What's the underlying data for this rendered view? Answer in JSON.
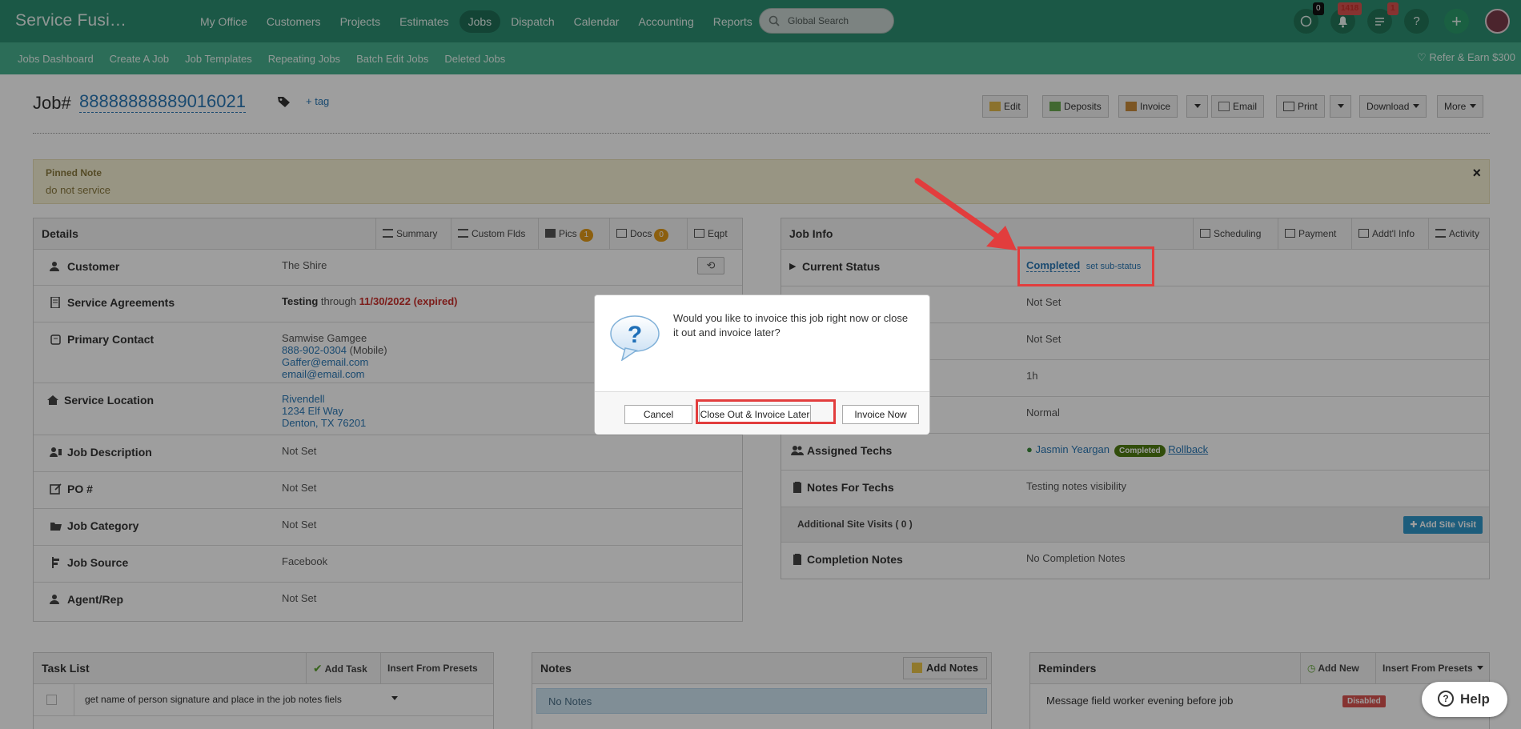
{
  "app": {
    "brand": "Service Fusi…"
  },
  "mainnav": [
    "My Office",
    "Customers",
    "Projects",
    "Estimates",
    "Jobs",
    "Dispatch",
    "Calendar",
    "Accounting",
    "Reports"
  ],
  "search": {
    "placeholder": "Global Search"
  },
  "top_icons": {
    "chat_badge": "0",
    "bell_badge": "1418",
    "list_badge": "1",
    "help_symbol": "?",
    "add_symbol": "+"
  },
  "subnav": [
    "Jobs Dashboard",
    "Create A Job",
    "Job Templates",
    "Repeating Jobs",
    "Batch Edit Jobs",
    "Deleted Jobs"
  ],
  "refer": "Refer & Earn $300",
  "job": {
    "label": "Job#",
    "number": "88888888889016021",
    "add_tag": "+ tag"
  },
  "actions": {
    "edit": "Edit",
    "deposits": "Deposits",
    "invoice": "Invoice",
    "email": "Email",
    "print": "Print",
    "download": "Download",
    "more": "More"
  },
  "pinned": {
    "title": "Pinned Note",
    "body": "do not service",
    "close": "×"
  },
  "details": {
    "title": "Details",
    "tabs": {
      "summary": "Summary",
      "custom": "Custom Flds",
      "pics": "Pics",
      "pics_count": "1",
      "docs": "Docs",
      "docs_count": "0",
      "eqpt": "Eqpt"
    },
    "customer_label": "Customer",
    "customer_value": "The Shire",
    "agreements_label": "Service Agreements",
    "agreements_name": "Testing",
    "agreements_through": "through",
    "agreements_date": "11/30/2022 (expired)",
    "contact_label": "Primary Contact",
    "contact_name": "Samwise Gamgee",
    "contact_phone": "888-902-0304",
    "contact_phone_type": "(Mobile)",
    "contact_email1": "Gaffer@email.com",
    "contact_email2": "email@email.com",
    "location_label": "Service Location",
    "location_name": "Rivendell",
    "location_street": "1234 Elf Way",
    "location_city": "Denton, TX 76201",
    "description_label": "Job Description",
    "description_value": "Not Set",
    "po_label": "PO #",
    "po_value": "Not Set",
    "category_label": "Job Category",
    "category_value": "Not Set",
    "source_label": "Job Source",
    "source_value": "Facebook",
    "agent_label": "Agent/Rep",
    "agent_value": "Not Set"
  },
  "jobinfo": {
    "title": "Job Info",
    "tabs": {
      "scheduling": "Scheduling",
      "payment": "Payment",
      "addl": "Addt'l Info",
      "activity": "Activity"
    },
    "status_label": "Current Status",
    "status_value": "Completed",
    "substatus": "set sub-status",
    "row2": "Not Set",
    "row3": "Not Set",
    "row4": "1h",
    "row5": "Normal",
    "techs_label": "Assigned Techs",
    "tech_name": "Jasmin Yeargan",
    "tech_badge": "Completed",
    "rollback": "Rollback",
    "notes_label": "Notes For Techs",
    "notes_value": "Testing notes visibility",
    "visits_label": "Additional Site Visits ( 0 )",
    "add_visit": "Add Site Visit",
    "completion_label": "Completion Notes",
    "completion_value": "No Completion Notes"
  },
  "tasks": {
    "title": "Task List",
    "add": "Add Task",
    "presets": "Insert From Presets",
    "item": "get name of person signature and place in the job notes fiels"
  },
  "notes": {
    "title": "Notes",
    "add": "Add Notes",
    "empty": "No Notes"
  },
  "reminders": {
    "title": "Reminders",
    "add": "Add New",
    "presets": "Insert From Presets",
    "item": "Message field worker evening before job",
    "item_badge": "Disabled"
  },
  "dialog": {
    "message": "Would you like to invoice this job right now or close it out and invoice later?",
    "cancel": "Cancel",
    "later": "Close Out & Invoice Later",
    "now": "Invoice Now"
  },
  "help": {
    "label": "Help",
    "symbol": "?"
  },
  "colors": {
    "nav": "#2c8f71",
    "subnav": "#47b18f",
    "link": "#2a78b5",
    "highlight": "#e23d3d"
  }
}
